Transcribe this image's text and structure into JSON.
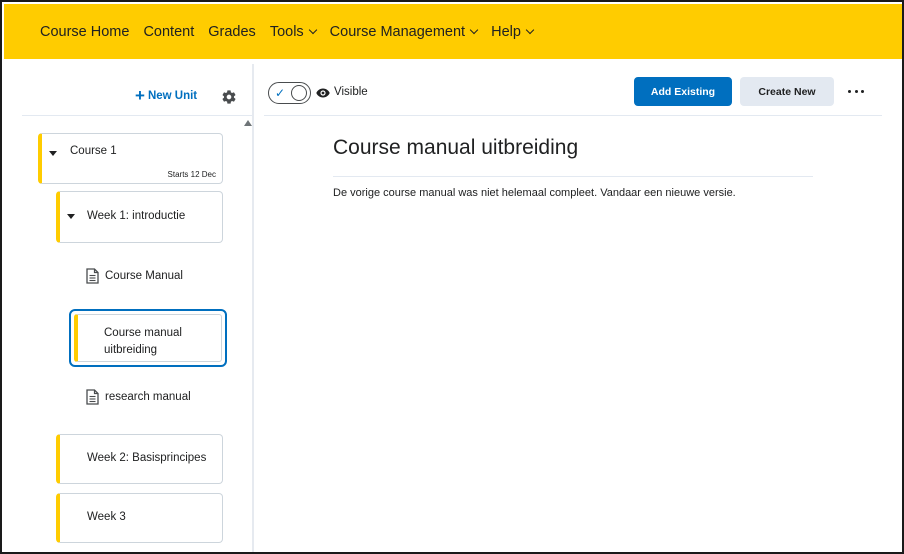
{
  "nav": {
    "items": [
      {
        "label": "Course Home",
        "dropdown": false
      },
      {
        "label": "Content",
        "dropdown": false
      },
      {
        "label": "Grades",
        "dropdown": false
      },
      {
        "label": "Tools",
        "dropdown": true
      },
      {
        "label": "Course Management",
        "dropdown": true
      },
      {
        "label": "Help",
        "dropdown": true
      }
    ],
    "background_color": "#ffcc00"
  },
  "sidebar": {
    "new_unit_label": "New Unit",
    "tree": {
      "course": {
        "label": "Course 1",
        "starts": "Starts 12 Dec"
      },
      "week1": {
        "label": "Week 1: introductie"
      },
      "topic_course_manual": {
        "label": "Course Manual"
      },
      "topic_selected": {
        "label": "Course manual uitbreiding"
      },
      "topic_research": {
        "label": "research manual"
      },
      "week2": {
        "label": "Week 2: Basisprincipes"
      },
      "week3": {
        "label": "Week 3"
      }
    }
  },
  "toolbar": {
    "visibility_label": "Visible",
    "visibility_on": true,
    "add_existing_label": "Add Existing",
    "create_new_label": "Create New"
  },
  "main": {
    "title": "Course manual uitbreiding",
    "description": "De vorige course manual was niet helemaal compleet. Vandaar een nieuwe versie."
  },
  "colors": {
    "accent": "#006fbf",
    "unit_bar": "#ffcc00"
  }
}
